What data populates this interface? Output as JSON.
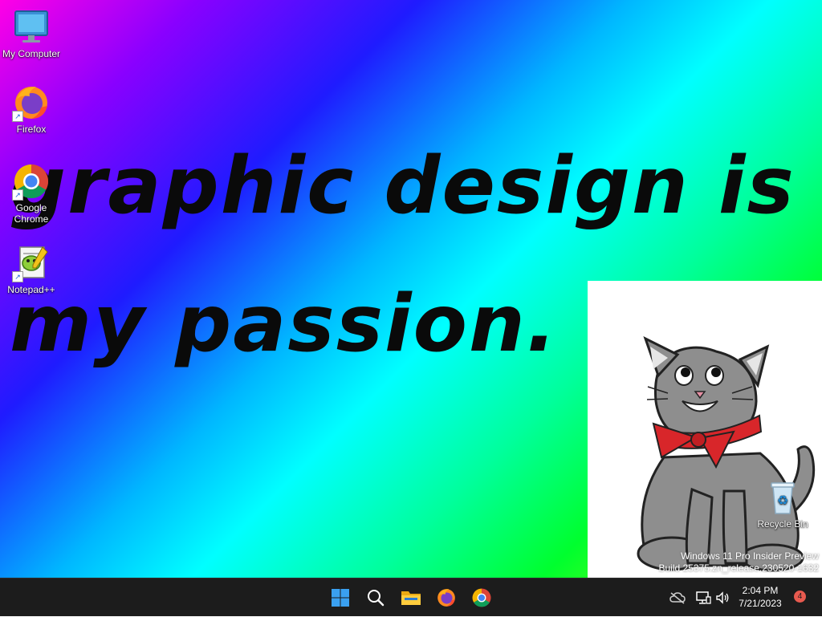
{
  "desktop": {
    "wallpaper_text_line1": "graphic design is",
    "wallpaper_text_line2": "my passion.",
    "icons": [
      {
        "label": "My Computer",
        "icon": "monitor-icon"
      },
      {
        "label": "Firefox",
        "icon": "firefox-icon"
      },
      {
        "label": "Google Chrome",
        "icon": "chrome-icon"
      },
      {
        "label": "Notepad++",
        "icon": "notepadpp-icon"
      },
      {
        "label": "Recycle Bin",
        "icon": "recycle-bin-icon"
      }
    ],
    "watermark": {
      "line1": "Windows 11 Pro Insider Preview",
      "line2": "Build 25375.zn_release.230520-1632"
    }
  },
  "taskbar": {
    "pinned": [
      {
        "name": "start",
        "icon": "windows-logo-icon"
      },
      {
        "name": "search",
        "icon": "search-icon"
      },
      {
        "name": "file-explorer",
        "icon": "folder-icon"
      },
      {
        "name": "firefox",
        "icon": "firefox-icon"
      },
      {
        "name": "chrome",
        "icon": "chrome-icon"
      }
    ],
    "tray": {
      "time": "2:04 PM",
      "date": "7/21/2023",
      "notification_count": "4"
    }
  },
  "colors": {
    "taskbar_bg": "#1c1c1c",
    "notification_badge": "#e85a4f",
    "accent_blue": "#0078d4"
  }
}
